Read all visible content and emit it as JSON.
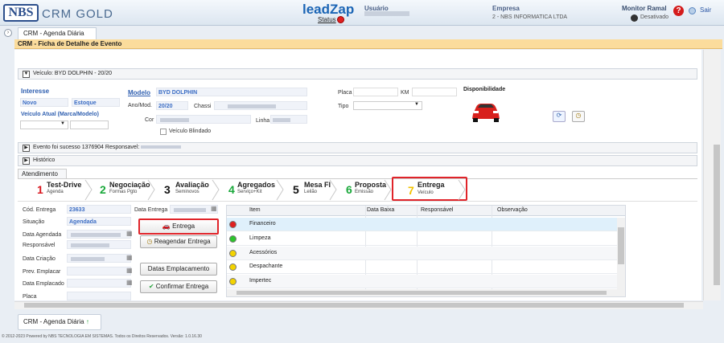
{
  "topbar": {
    "logo_nbs": "NBS",
    "logo_crm": "CRM GOLD",
    "leadzap": "leadZap",
    "leadzap_status": "Status",
    "usuario_label": "Usuário",
    "empresa_label": "Empresa",
    "empresa_value": "2 - NBS INFORMATICA LTDA",
    "monitor_label": "Monitor Ramal",
    "monitor_status": "Desativado",
    "help": "?",
    "sair": "Sair"
  },
  "tabs": {
    "main_tab": "CRM - Agenda Diária",
    "close": "×"
  },
  "page_title": "CRM - Ficha de Detalhe de Evento",
  "vehicle_bar": "Veículo: BYD DOLPHIN - 20/20",
  "interesse": {
    "title": "Interesse",
    "novo": "Novo",
    "estoque": "Estoque",
    "veiculo_atual": "Veículo Atual (Marca/Modelo)"
  },
  "modelo": {
    "label": "Modelo",
    "value": "BYD DOLPHIN",
    "anomod_label": "Ano/Mod.",
    "anomod_value": "20/20",
    "chassi_label": "Chassi",
    "cor_label": "Cor",
    "linha_label": "Linha",
    "blindado_label": "Veículo Blindado"
  },
  "placa": {
    "placa_label": "Placa",
    "km_label": "KM",
    "tipo_label": "Tipo"
  },
  "disponibilidade": "Disponibilidade",
  "evento_bar": "Evento foi sucesso 1376904 Responsavel:",
  "historico_bar": "Histórico",
  "atendimento_tab": "Atendimento",
  "steps": [
    {
      "num": "1",
      "title": "Test-Drive",
      "sub": "Agenda",
      "color": "#d9141c"
    },
    {
      "num": "2",
      "title": "Negociação",
      "sub": "Formas Pgto",
      "color": "#19a83a"
    },
    {
      "num": "3",
      "title": "Avaliação",
      "sub": "Seminovos",
      "color": "#111111"
    },
    {
      "num": "4",
      "title": "Agregados",
      "sub": "Serviço+Kit",
      "color": "#19a83a"
    },
    {
      "num": "5",
      "title": "Mesa FI",
      "sub": "Leilão",
      "color": "#111111"
    },
    {
      "num": "6",
      "title": "Proposta",
      "sub": "Emissão",
      "color": "#19a83a"
    },
    {
      "num": "7",
      "title": "Entrega",
      "sub": "Veículo",
      "color": "#f2c200"
    }
  ],
  "entrega_form": {
    "cod_label": "Cód. Entrega",
    "cod_value": "23633",
    "data_entrega_label": "Data Entrega",
    "situacao_label": "Situação",
    "situacao_value": "Agendada",
    "data_agendada_label": "Data Agendada",
    "responsavel_label": "Responsável",
    "data_criacao_label": "Data Criação",
    "prev_emplacar_label": "Prev. Emplacar",
    "data_emplacado_label": "Data Emplacado",
    "placa_label": "Placa"
  },
  "buttons": {
    "entrega": "Entrega",
    "reagendar": "Reagendar Entrega",
    "datas_emplacamento": "Datas Emplacamento",
    "confirmar": "Confirmar Entrega"
  },
  "grid": {
    "headers": [
      "Item",
      "Data Baixa",
      "Responsável",
      "Observação"
    ],
    "rows": [
      {
        "item": "Financeiro",
        "status": "red"
      },
      {
        "item": "Limpeza",
        "status": "green"
      },
      {
        "item": "Acessórios",
        "status": "yellow"
      },
      {
        "item": "Despachante",
        "status": "yellow"
      },
      {
        "item": "Impertec",
        "status": "yellow"
      }
    ]
  },
  "footer": {
    "tab": "CRM - Agenda Diária",
    "copyright": "© 2012-2023 Powered by NBS TECNOLOGIA EM SISTEMAS. Todos os Direitos Reservados.   Versão: 1.0.16.30"
  },
  "colors": {
    "accent_orange": "#fbdc9c",
    "highlight_red": "#e0242a",
    "link_blue": "#2f5fb0"
  }
}
